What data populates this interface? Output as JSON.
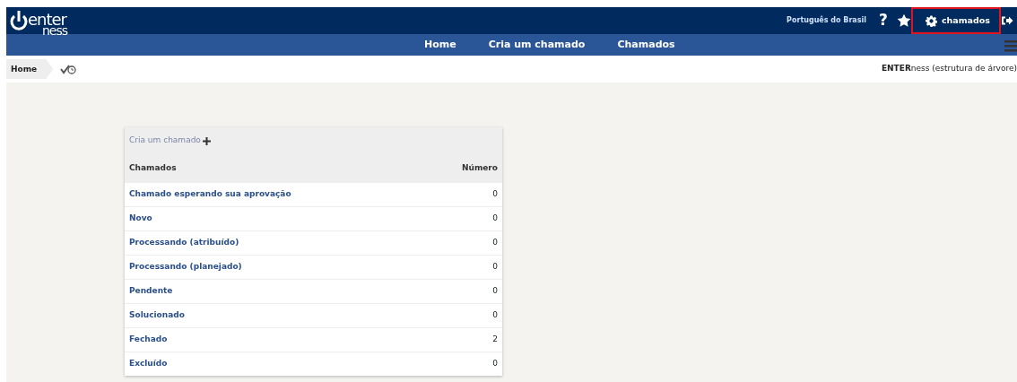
{
  "logo": {
    "line_1": "enter",
    "line_2": "ness"
  },
  "top_bar": {
    "language": "Português do Brasil",
    "help": "?",
    "user_menu": {
      "label": "chamados",
      "highlighted": true
    }
  },
  "nav": [
    {
      "label": "Home"
    },
    {
      "label": "Cria um chamado"
    },
    {
      "label": "Chamados"
    }
  ],
  "breadcrumb": {
    "label": "Home"
  },
  "tree_title": {
    "bold": "ENTER",
    "rest": "ness (estrutura de árvore)"
  },
  "card": {
    "create_link": "Cria um chamado",
    "columns": [
      "Chamados",
      "Número"
    ],
    "rows": [
      {
        "label": "Chamado esperando sua aprovação",
        "count": "0"
      },
      {
        "label": "Novo",
        "count": "0"
      },
      {
        "label": "Processando (atribuído)",
        "count": "0"
      },
      {
        "label": "Processando (planejado)",
        "count": "0"
      },
      {
        "label": "Pendente",
        "count": "0"
      },
      {
        "label": "Solucionado",
        "count": "0"
      },
      {
        "label": "Fechado",
        "count": "2"
      },
      {
        "label": "Excluído",
        "count": "0"
      }
    ]
  }
}
